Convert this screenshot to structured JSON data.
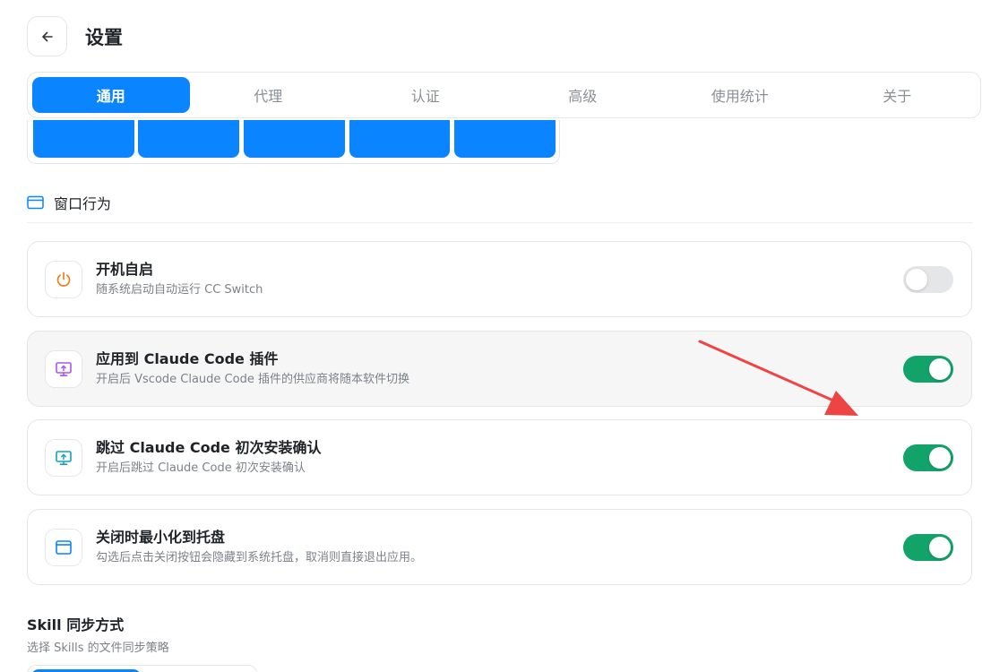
{
  "header": {
    "title": "设置"
  },
  "tabs": [
    {
      "label": "通用",
      "active": true
    },
    {
      "label": "代理",
      "active": false
    },
    {
      "label": "认证",
      "active": false
    },
    {
      "label": "高级",
      "active": false
    },
    {
      "label": "使用统计",
      "active": false
    },
    {
      "label": "关于",
      "active": false
    }
  ],
  "section": {
    "title": "窗口行为"
  },
  "cards": [
    {
      "title": "开机自启",
      "desc": "随系统启动自动运行 CC Switch",
      "on": false,
      "icon": "power-icon"
    },
    {
      "title": "应用到 Claude Code 插件",
      "desc": "开启后 Vscode Claude Code 插件的供应商将随本软件切换",
      "on": true,
      "icon": "monitor-upload-icon"
    },
    {
      "title": "跳过 Claude Code 初次安装确认",
      "desc": "开启后跳过 Claude Code 初次安装确认",
      "on": true,
      "icon": "monitor-upload-icon"
    },
    {
      "title": "关闭时最小化到托盘",
      "desc": "勾选后点击关闭按钮会隐藏到系统托盘，取消则直接退出应用。",
      "on": true,
      "icon": "window-icon"
    }
  ],
  "skill": {
    "title": "Skill 同步方式",
    "desc": "选择 Skills 的文件同步策略"
  },
  "colors": {
    "accent": "#0a84ff",
    "toggle_on": "#12a36b",
    "toggle_off": "#e5e6e8",
    "arrow": "#ef4444"
  }
}
